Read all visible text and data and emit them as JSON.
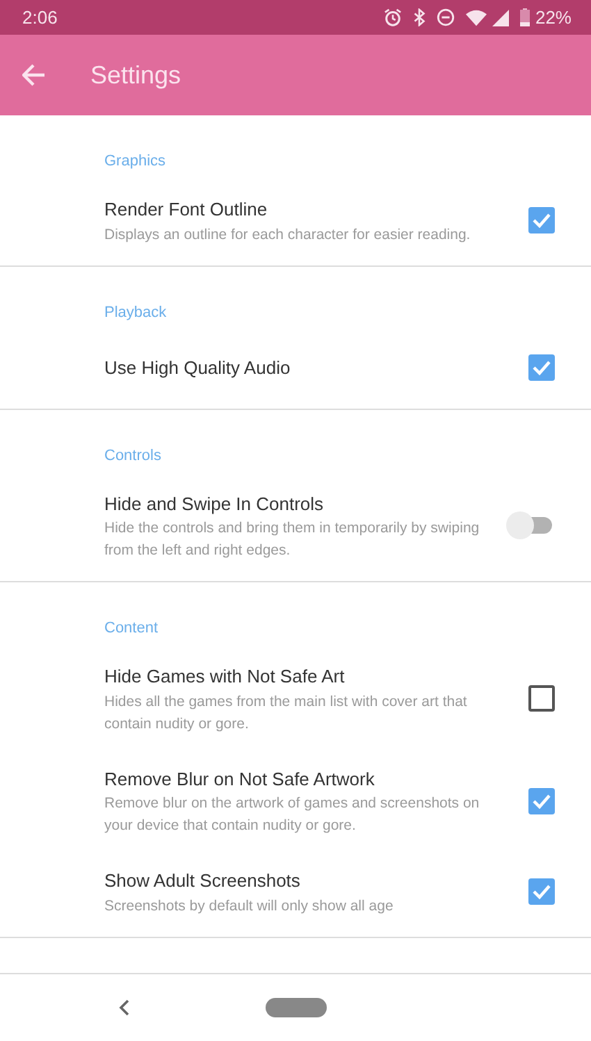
{
  "status_bar": {
    "time": "2:06",
    "battery": "22%"
  },
  "app_bar": {
    "title": "Settings"
  },
  "sections": [
    {
      "title": "Graphics",
      "items": [
        {
          "kind": "checkbox",
          "title": "Render Font Outline",
          "description": "Displays an outline for each character for easier reading.",
          "checked": true
        }
      ]
    },
    {
      "title": "Playback",
      "items": [
        {
          "kind": "checkbox",
          "title": "Use High Quality Audio",
          "checked": true
        }
      ]
    },
    {
      "title": "Controls",
      "items": [
        {
          "kind": "switch",
          "title": "Hide and Swipe In Controls",
          "description": "Hide the controls and bring them in temporarily by swiping from the left and right edges.",
          "on": false
        }
      ]
    },
    {
      "title": "Content",
      "items": [
        {
          "kind": "checkbox",
          "title": "Hide Games with Not Safe Art",
          "description": "Hides all the games from the main list with cover art that contain nudity or gore.",
          "checked": false
        },
        {
          "kind": "checkbox",
          "title": "Remove Blur on Not Safe Artwork",
          "description": "Remove blur on the artwork of games and screenshots on your device that contain nudity or gore.",
          "checked": true
        },
        {
          "kind": "checkbox",
          "title": "Show Adult Screenshots",
          "description": "Screenshots by default will only show all age",
          "checked": true
        }
      ]
    }
  ]
}
